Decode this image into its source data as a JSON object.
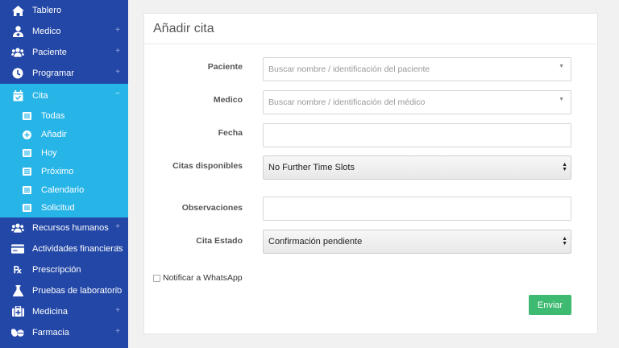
{
  "sidebar": {
    "items_top": [
      {
        "label": "Tablero",
        "icon": "home-icon",
        "plus": false
      },
      {
        "label": "Medico",
        "icon": "doctor-icon",
        "plus": true
      },
      {
        "label": "Paciente",
        "icon": "patients-icon",
        "plus": true
      },
      {
        "label": "Programar",
        "icon": "clock-icon",
        "plus": true
      }
    ],
    "active": {
      "label": "Cita",
      "icon": "calendar-check-icon",
      "toggle": "−"
    },
    "sub_items": [
      "Todas",
      "Añadir",
      "Hoy",
      "Próximo",
      "Calendario",
      "Solicitud"
    ],
    "items_bottom": [
      {
        "label": "Recursos humanos",
        "icon": "users-icon",
        "plus": true
      },
      {
        "label": "Actividades financieras",
        "icon": "credit-card-icon",
        "plus": true
      },
      {
        "label": "Prescripción",
        "icon": "rx-icon",
        "plus": false
      },
      {
        "label": "Pruebas de laboratorio",
        "icon": "flask-icon",
        "plus": true
      },
      {
        "label": "Medicina",
        "icon": "medkit-icon",
        "plus": true
      },
      {
        "label": "Farmacia",
        "icon": "pills-icon",
        "plus": true
      }
    ],
    "plus_symbol": "+"
  },
  "form": {
    "title": "Añadir cita",
    "paciente": {
      "label": "Paciente",
      "placeholder": "Buscar nombre / identificación del paciente"
    },
    "medico": {
      "label": "Medico",
      "placeholder": "Buscar nombre / identificación del médico"
    },
    "fecha": {
      "label": "Fecha",
      "value": ""
    },
    "citas": {
      "label": "Citas disponibles",
      "value": "No Further Time Slots"
    },
    "observaciones": {
      "label": "Observaciones",
      "value": ""
    },
    "estado": {
      "label": "Cita Estado",
      "value": "Confirmación pendiente"
    },
    "whatsapp": {
      "label": "Notificar a WhatsApp",
      "checked": false
    },
    "submit_label": "Enviar"
  },
  "colors": {
    "sidebar": "#2347a6",
    "active": "#27b5e8",
    "submit": "#3fba72"
  }
}
